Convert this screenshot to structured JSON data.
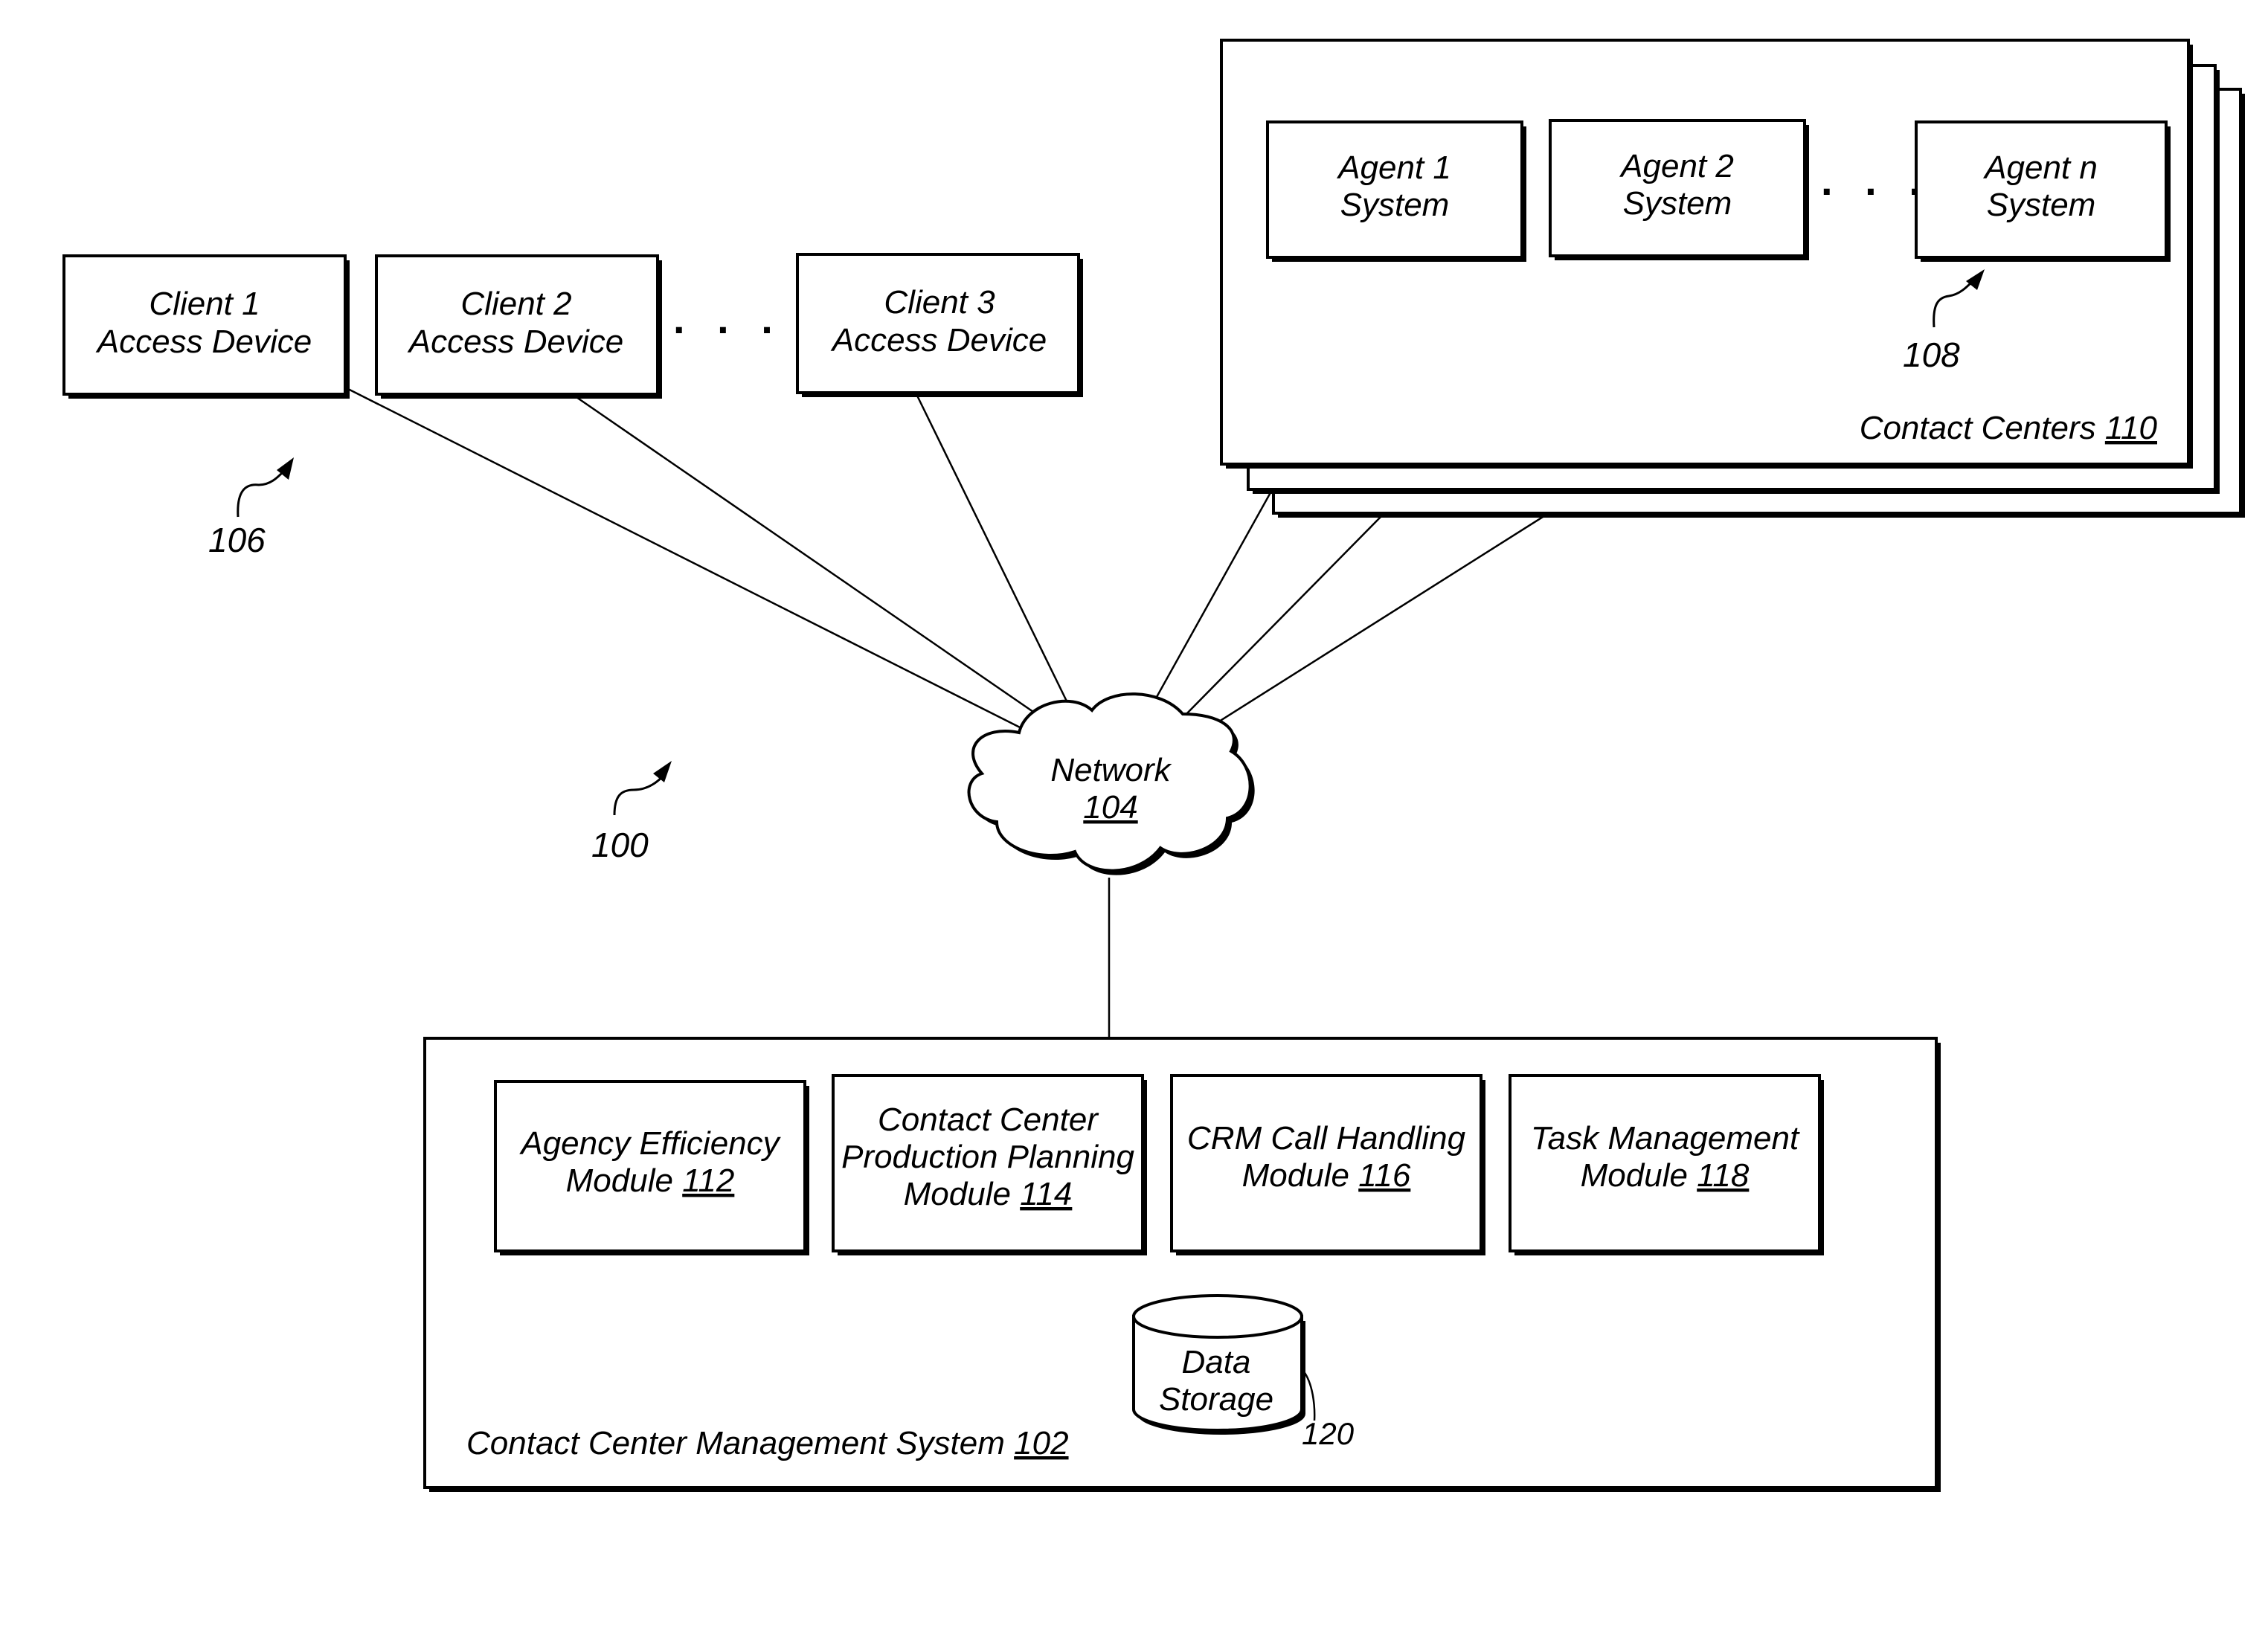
{
  "diagram": {
    "system_ref": "100",
    "clients_ref": "106",
    "agents_ref": "108",
    "ellipsis": ". . .",
    "clients": [
      {
        "line1": "Client 1",
        "line2": "Access Device"
      },
      {
        "line1": "Client 2",
        "line2": "Access Device"
      },
      {
        "line1": "Client 3",
        "line2": "Access Device"
      }
    ],
    "contact_centers": {
      "label": "Contact Centers ",
      "ref": "110",
      "agents": [
        {
          "line1": "Agent 1",
          "line2": "System"
        },
        {
          "line1": "Agent 2",
          "line2": "System"
        },
        {
          "line1": "Agent n",
          "line2": "System"
        }
      ]
    },
    "network": {
      "label": "Network",
      "ref": "104"
    },
    "management_system": {
      "label": "Contact Center Management System ",
      "ref": "102",
      "modules": [
        {
          "lines": [
            "Agency Efficiency"
          ],
          "last_prefix": "Module ",
          "ref": "112"
        },
        {
          "lines": [
            "Contact Center",
            "Production Planning"
          ],
          "last_prefix": "Module ",
          "ref": "114"
        },
        {
          "lines": [
            "CRM Call Handling"
          ],
          "last_prefix": "Module ",
          "ref": "116"
        },
        {
          "lines": [
            "Task Management"
          ],
          "last_prefix": "Module ",
          "ref": "118"
        }
      ],
      "data_storage": {
        "line1": "Data",
        "line2": "Storage",
        "ref": "120"
      }
    }
  }
}
